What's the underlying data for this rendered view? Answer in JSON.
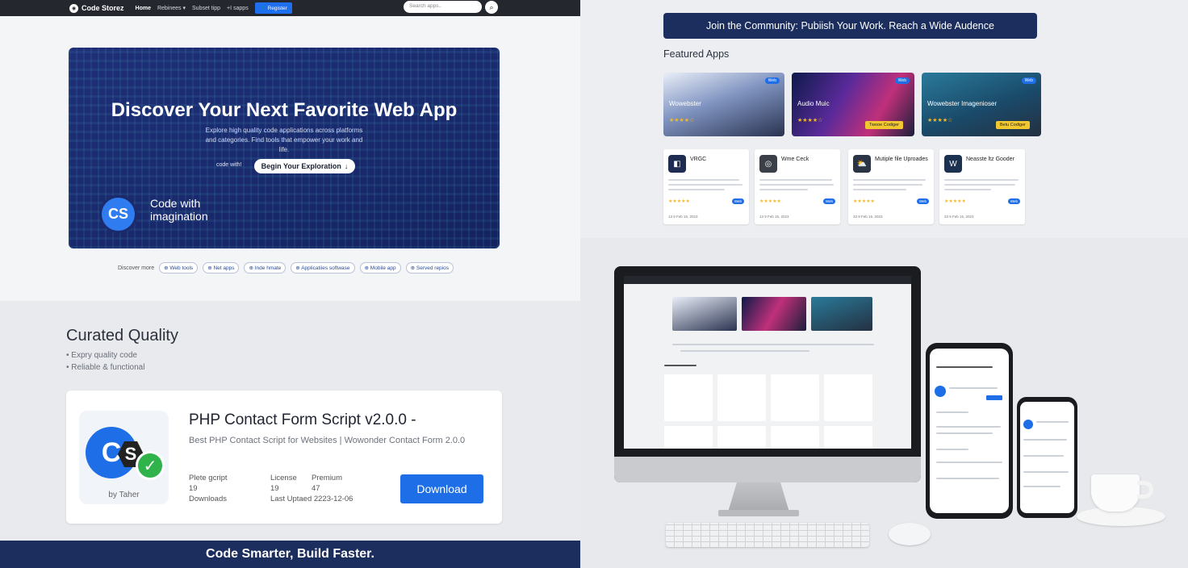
{
  "nav": {
    "brand": "Code Storez",
    "home": "Home",
    "items": [
      "Rebinees ▾",
      "Subset tipp",
      "+I sapps"
    ],
    "register": "Register",
    "search_placeholder": "Search apps..",
    "search_icon": "search-icon"
  },
  "hero": {
    "title": "Discover Your Next Favorite Web App",
    "subtitle": "Explore high quality code applications across platforms and categories. Find tools that empower your work and life.",
    "code_label": "code with!",
    "cta": "Begin Your Exploration",
    "cta_icon": "↓",
    "logo_text": "CS",
    "tagline": "Code with imagination"
  },
  "discover": {
    "label": "Discover more",
    "chips": [
      "Web tools",
      "Net apps",
      "Inde hmate",
      "Applicatiies softwase",
      "Mobile app",
      "Served repios"
    ]
  },
  "curated": {
    "title": "Curated Quality",
    "points": [
      "Expry quality code",
      "Reliable & functional"
    ]
  },
  "product": {
    "by": "by Taher",
    "title": "PHP Contact Form Script v2.0.0 -",
    "subtitle": "Best PHP Contact Script for Websites | Wowonder Contact Form 2.0.0",
    "meta_a_label": "Plete gcript",
    "meta_a_value": "19",
    "meta_a_sub": "Downloads",
    "meta_b_label": "License",
    "meta_b_value": "19",
    "meta_c_label": "Premium",
    "meta_c_value": "47",
    "last_updated": "Last Uptaed 2223-12-06",
    "download": "Download"
  },
  "footer": {
    "slogan": "Code Smarter, Build Faster."
  },
  "community": {
    "banner": "Join the Community: Pubiish Your Work. Reach a Wide Audence"
  },
  "featured": {
    "title": "Featured Apps",
    "items": [
      {
        "name": "Wowebster",
        "badge": "Web",
        "stars": "★★★★☆",
        "button": ""
      },
      {
        "name": "Audio Muic",
        "badge": "Web",
        "stars": "★★★★☆",
        "button": "Twooe Codiger"
      },
      {
        "name": "Wowebster Imagenioser",
        "badge": "Web",
        "stars": "★★★★☆",
        "button": "Betu Codiger"
      }
    ]
  },
  "cards": [
    {
      "name": "VRGC",
      "icon": "◧",
      "stars": "★★★★★",
      "btn": "Web",
      "foot": "13   9   Feb 15, 2023"
    },
    {
      "name": "Wme Ceck",
      "icon": "◎",
      "stars": "★★★★★",
      "btn": "Web",
      "foot": "13   9   Feb 15, 2023"
    },
    {
      "name": "Mutiple file Uproades",
      "icon": "⛅",
      "stars": "★★★★★",
      "btn": "Web",
      "foot": "33   9   Feb 15, 2023"
    },
    {
      "name": "Neasste ltz Gooder",
      "icon": "W",
      "stars": "★★★★★",
      "btn": "Web",
      "foot": "33   9   Feb 15, 2023"
    }
  ],
  "colors": {
    "navy": "#1c2e5e",
    "accent": "#1e6ee8",
    "star": "#f4b928"
  }
}
